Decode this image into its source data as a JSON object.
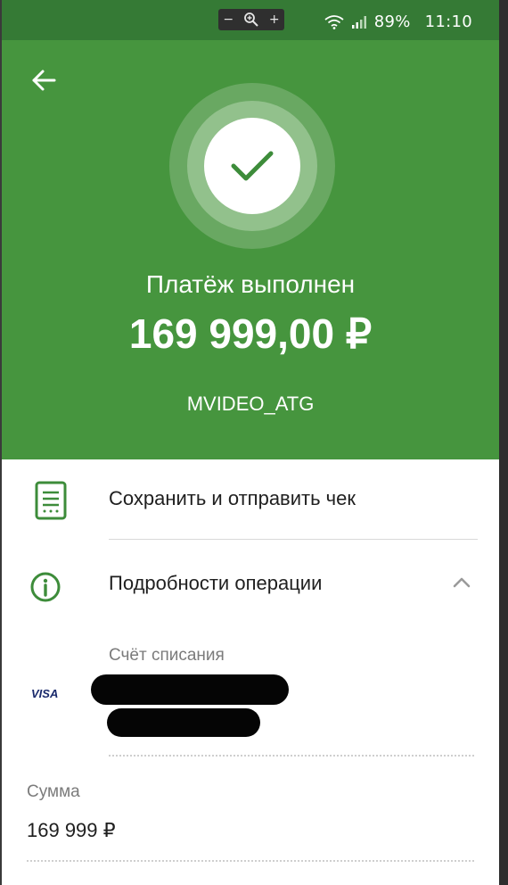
{
  "status_bar": {
    "zoom_out": "−",
    "zoom_in": "+",
    "battery": "89%",
    "time": "11:10",
    "icons": [
      "wifi-icon",
      "signal-icon"
    ]
  },
  "header": {
    "title": "Платёж выполнен",
    "amount": "169 999,00 ₽",
    "merchant": "MVIDEO_ATG",
    "accent_color": "#46953e"
  },
  "actions": {
    "save_receipt": "Сохранить и отправить чек",
    "details": "Подробности операции"
  },
  "details": {
    "debit_account_label": "Счёт списания",
    "card_brand": "VISA",
    "amount_label": "Сумма",
    "amount_value": "169 999 ₽"
  }
}
